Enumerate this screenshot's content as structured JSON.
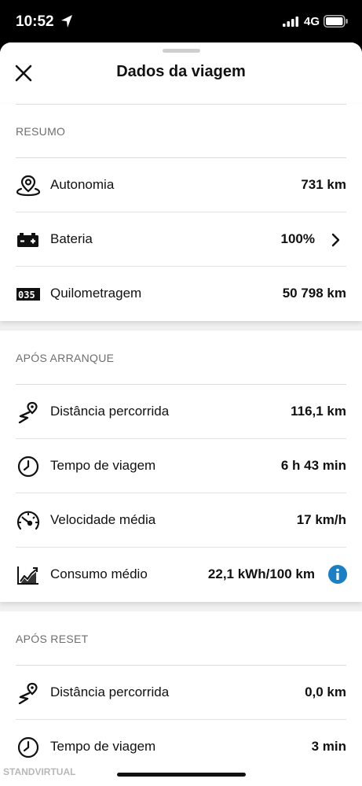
{
  "status_bar": {
    "time": "10:52",
    "network": "4G"
  },
  "header": {
    "title": "Dados da viagem"
  },
  "sections": [
    {
      "title": "RESUMO",
      "rows": [
        {
          "icon": "location-pin-icon",
          "label": "Autonomia",
          "value": "731 km"
        },
        {
          "icon": "battery-icon",
          "label": "Bateria",
          "value": "100%"
        },
        {
          "icon": "odometer-icon",
          "label": "Quilometragem",
          "value": "50 798 km"
        }
      ]
    },
    {
      "title": "APÓS ARRANQUE",
      "rows": [
        {
          "icon": "route-icon",
          "label": "Distância percorrida",
          "value": "116,1 km"
        },
        {
          "icon": "clock-icon",
          "label": "Tempo de viagem",
          "value": "6 h 43 min"
        },
        {
          "icon": "speedometer-icon",
          "label": "Velocidade média",
          "value": "17 km/h"
        },
        {
          "icon": "consumption-chart-icon",
          "label": "Consumo médio",
          "value": "22,1 kWh/100 km"
        }
      ]
    },
    {
      "title": "APÓS RESET",
      "rows": [
        {
          "icon": "route-icon",
          "label": "Distância percorrida",
          "value": "0,0 km"
        },
        {
          "icon": "clock-icon",
          "label": "Tempo de viagem",
          "value": "3 min"
        }
      ]
    }
  ],
  "odometer_digits": "035",
  "watermark": "STANDVIRTUAL"
}
